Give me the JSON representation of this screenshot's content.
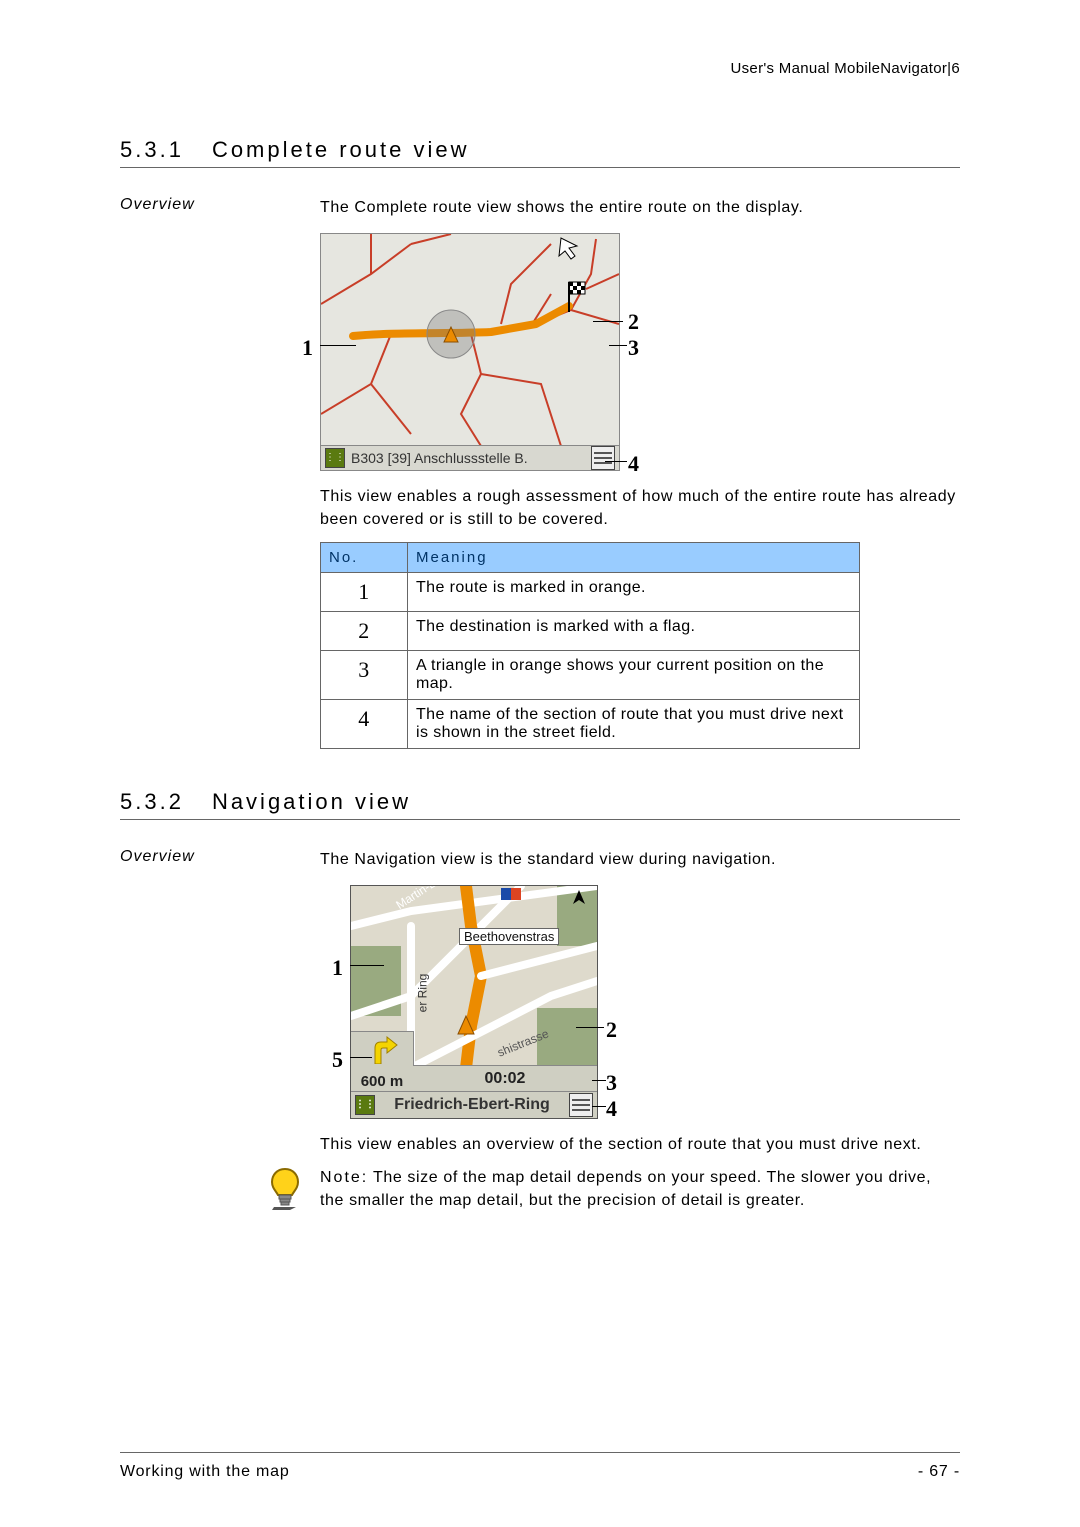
{
  "header": {
    "doc_title": "User's Manual MobileNavigator|6"
  },
  "section1": {
    "number": "5.3.1",
    "title": "Complete route view",
    "sidelabel": "Overview",
    "intro": "The Complete route view shows the entire route on the display.",
    "fig": {
      "street_text": "B303 [39] Anschlussstelle B.",
      "callouts": {
        "c1": "1",
        "c2": "2",
        "c3": "3",
        "c4": "4"
      }
    },
    "after_fig": "This view enables a rough assessment of how much of the entire route has already been covered or is still to be covered.",
    "table": {
      "headers": {
        "no": "No.",
        "meaning": "Meaning"
      },
      "rows": [
        {
          "n": "1",
          "m": "The route is marked in orange."
        },
        {
          "n": "2",
          "m": "The destination is marked with a flag."
        },
        {
          "n": "3",
          "m": "A triangle in orange shows your current position on the map."
        },
        {
          "n": "4",
          "m": "The name of the section of route that you must drive next is shown in the street field."
        }
      ]
    }
  },
  "section2": {
    "number": "5.3.2",
    "title": "Navigation view",
    "sidelabel": "Overview",
    "intro": "The Navigation view is the standard view during navigation.",
    "fig": {
      "label_beethoven": "Beethovenstras",
      "label_mls": "Martin-Luther-Strasse",
      "label_ring": "er Ring",
      "label_hist": "shistrasse",
      "distance": "600 m",
      "time": "00:02",
      "street": "Friedrich-Ebert-Ring",
      "callouts": {
        "c1": "1",
        "c2": "2",
        "c3": "3",
        "c4": "4",
        "c5": "5"
      }
    },
    "after_fig": "This view enables an overview of the section of route that you must drive next.",
    "note_label": "Note:",
    "note": " The size of the map detail depends on your speed. The slower you drive, the smaller the map detail, but the precision of detail is greater."
  },
  "footer": {
    "left": "Working with the map",
    "right": "- 67 -"
  }
}
